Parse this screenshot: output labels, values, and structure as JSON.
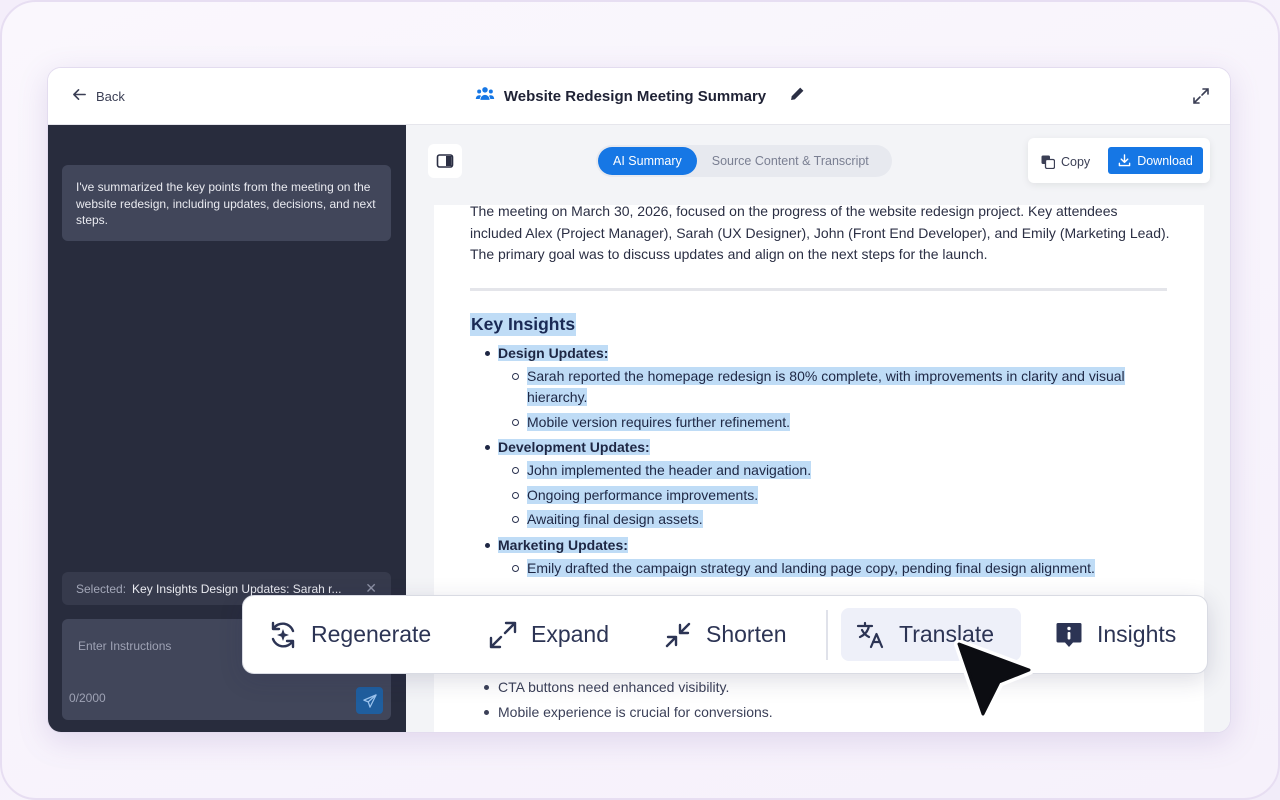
{
  "header": {
    "back_label": "Back",
    "title": "Website Redesign Meeting Summary"
  },
  "sidebar": {
    "assistant_message": "I've summarized the key points from the meeting on the website redesign, including updates, decisions, and next steps.",
    "selected_label": "Selected:",
    "selected_value": "Key Insights Design Updates: Sarah r...",
    "instructions_placeholder": "Enter Instructions",
    "char_counter": "0/2000"
  },
  "tabs": [
    {
      "label": "AI Summary",
      "active": true
    },
    {
      "label": "Source Content & Transcript",
      "active": false
    }
  ],
  "actions": {
    "copy_label": "Copy",
    "download_label": "Download"
  },
  "document": {
    "intro": "The meeting on March 30, 2026, focused on the progress of the website redesign project. Key attendees included Alex (Project Manager), Sarah (UX Designer), John (Front End Developer), and Emily (Marketing Lead). The primary goal was to discuss updates and align on the next steps for the launch.",
    "section_title": "Key Insights",
    "groups": [
      {
        "title": "Design Updates:",
        "items": [
          "Sarah reported the homepage redesign is 80% complete, with improvements in clarity and visual hierarchy.",
          "Mobile version requires further refinement."
        ]
      },
      {
        "title": "Development Updates:",
        "items": [
          "John implemented the header and navigation.",
          "Ongoing performance improvements.",
          "Awaiting final design assets."
        ]
      },
      {
        "title": "Marketing Updates:",
        "items": [
          "Emily drafted the campaign strategy and landing page copy, pending final design alignment."
        ]
      }
    ],
    "lower_items": [
      "CTA buttons need enhanced visibility.",
      "Mobile experience is crucial for conversions."
    ]
  },
  "toolbar": {
    "regenerate": "Regenerate",
    "expand": "Expand",
    "shorten": "Shorten",
    "translate": "Translate",
    "insights": "Insights",
    "active": "translate"
  },
  "colors": {
    "accent": "#1677e5",
    "sidebar_bg": "#282c3d",
    "highlight": "#bfdcf6"
  }
}
